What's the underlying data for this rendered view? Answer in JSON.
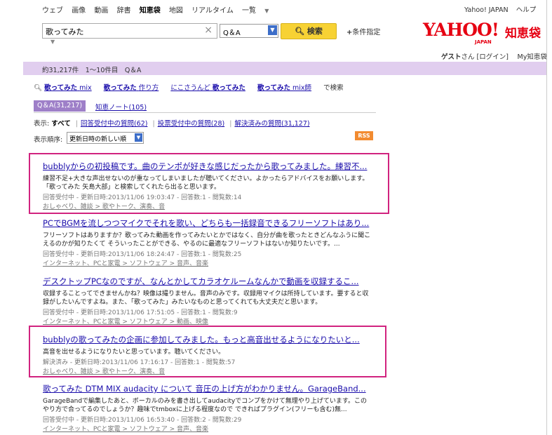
{
  "topnav": {
    "items": [
      "ウェブ",
      "画像",
      "動画",
      "辞書",
      "知恵袋",
      "地図",
      "リアルタイム",
      "一覧"
    ],
    "right": [
      "Yahoo! JAPAN",
      "ヘルプ"
    ]
  },
  "search": {
    "query": "歌ってみた",
    "clear": "×",
    "scope": "Q＆A",
    "button": "検索",
    "advanced": "条件指定"
  },
  "logo": {
    "main": "YAHOO!",
    "sub": "JAPAN",
    "chie": "知恵袋"
  },
  "user": {
    "guest": "ゲスト",
    "san": "さん",
    "login": "ログイン",
    "mychie": "My知恵袋"
  },
  "summary": "約31,217件　1～10件目　Q＆A",
  "related": {
    "items": [
      {
        "kw": "歌ってみた",
        "rest": "mix"
      },
      {
        "kw": "歌ってみた",
        "rest": "作り方"
      },
      {
        "pre": "にこさうんど",
        "kw": "歌ってみた"
      },
      {
        "kw": "歌ってみた",
        "rest": "mix師"
      }
    ],
    "suffix": "で検索"
  },
  "tabs": {
    "qa": "Q＆A(31,217)",
    "note": "知恵ノート(105)"
  },
  "filter": {
    "label": "表示:",
    "all": "すべて",
    "answering": "回答受付中の質問(62)",
    "voting": "投票受付中の質問(28)",
    "resolved": "解決済みの質問(31,127)"
  },
  "sort": {
    "label": "表示順序:",
    "value": "更新日時の新しい順"
  },
  "rss": "RSS",
  "results": [
    {
      "title": "bubblyからの初投稿です。曲のテンポが好きな感じだったから歌ってみました。練習不...",
      "snippet": "練習不足+大きな声出せないのが重なってしまいましたが聴いてください。よかったらアドバイスをお願いします。「歌ってみた 矢島大部」と検索してくれたら出ると思います。",
      "meta": "回答受付中 - 更新日時:2013/11/06 19:03:47 - 回答数:1 - 閲覧数:14",
      "category": "おしゃべり、雑談 > 歌やトーク、演奏、音"
    },
    {
      "title": "PCでBGMを流しつつマイクでそれを歌い、どちらも一括録音できるフリーソフトはあり...",
      "snippet": "フリーソフトはありますか？歌ってみた動画を作ってみたいとかではなく、自分が曲を歌ったときどんなふうに聞こえるのかが知りたくて そういったことができる、やるのに最適なフリーソフトはないか知りたいです。...",
      "meta": "回答受付中 - 更新日時:2013/11/06 18:24:47 - 回答数:1 - 閲覧数:25",
      "category": "インターネット、PCと家電 > ソフトウェア > 音声、音楽"
    },
    {
      "title": "デスクトップPCなのですが、なんとかしてカラオケルームなんかで動画を収録するこ...",
      "snippet": "収録することってできませんかね？映像は撮りません。音声のみです。収録用マイクは所持しています。要すると収録がしたいんですよね。また、「歌ってみた」みたいなものと思ってくれても大丈夫だと思います。",
      "meta": "回答受付中 - 更新日時:2013/11/06 17:51:05 - 回答数:1 - 閲覧数:9",
      "category": "インターネット、PCと家電 > ソフトウェア > 動画、映像"
    },
    {
      "title": "bubblyの歌ってみたの企画に参加してみました。もっと高音出せるようになりたいと...",
      "snippet": "高音を出せるようになりたいと思っています。聴いてください。",
      "meta": "解決済み - 更新日時:2013/11/06 17:16:17 - 回答数:1 - 閲覧数:57",
      "category": "おしゃべり、雑談 > 歌やトーク、演奏、音"
    },
    {
      "title": "歌ってみた DTM MIX audacity について 音圧の上げ方がわかりません。GarageBand...",
      "snippet": "GarageBandで編集したあと、ボーカルのみを書き出してaudacityでコンプをかけて無理やり上げています。このやり方で合ってるのでしょうか？趣味でtmboxに上げる程度なので できればプラグイン(フリーも含む)無...",
      "meta": "回答受付中 - 更新日時:2013/11/06 16:53:40 - 回答数:2 - 閲覧数:29",
      "category": "インターネット、PCと家電 > ソフトウェア > 音声、音楽"
    }
  ]
}
